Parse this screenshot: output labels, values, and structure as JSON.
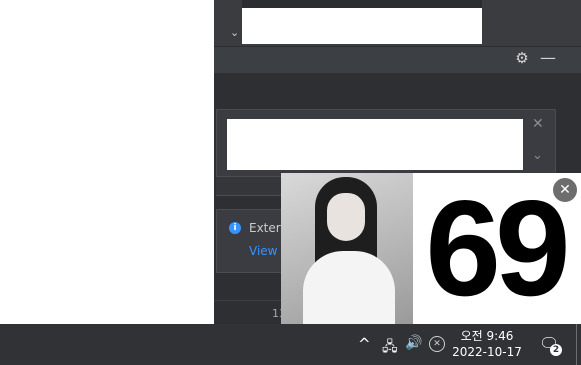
{
  "ide": {
    "icons": {
      "gear": "gear-icon",
      "minus": "minimize-icon",
      "close": "close-icon",
      "expand": "chevron-down-icon",
      "info": "info-icon"
    },
    "notification_info": {
      "text": "Extern",
      "link": "View F"
    },
    "status_number": "13"
  },
  "popup": {
    "number": "69",
    "close_icon": "close-icon"
  },
  "taskbar": {
    "time": "오전 9:46",
    "date": "2022-10-17",
    "notification_count": "2",
    "icons": [
      "chevron-up-icon",
      "network-icon",
      "volume-icon",
      "x-circle-icon",
      "action-center-icon"
    ]
  },
  "colors": {
    "taskbar_bg": "#303236",
    "ide_bg": "#2b2d30",
    "link_blue": "#3794ff"
  }
}
